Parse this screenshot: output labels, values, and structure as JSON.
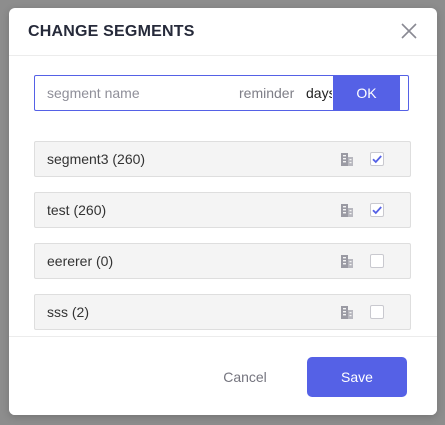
{
  "dialog": {
    "title": "CHANGE SEGMENTS"
  },
  "create_form": {
    "segment_placeholder": "segment name",
    "segment_value": "",
    "reminder_label": "reminder",
    "days_value": "days",
    "ok_label": "OK"
  },
  "segments": [
    {
      "name": "segment3 (260)",
      "checked": true
    },
    {
      "name": "test (260)",
      "checked": true
    },
    {
      "name": "eererer (0)",
      "checked": false
    },
    {
      "name": "sss (2)",
      "checked": false
    }
  ],
  "footer": {
    "cancel_label": "Cancel",
    "save_label": "Save"
  },
  "colors": {
    "accent": "#5561e6",
    "overlay": "#8d8d8d",
    "row_background": "#f4f4f4"
  },
  "icons": {
    "close": "close-icon",
    "segment_doc": "document-icon",
    "check": "checkmark-icon"
  }
}
